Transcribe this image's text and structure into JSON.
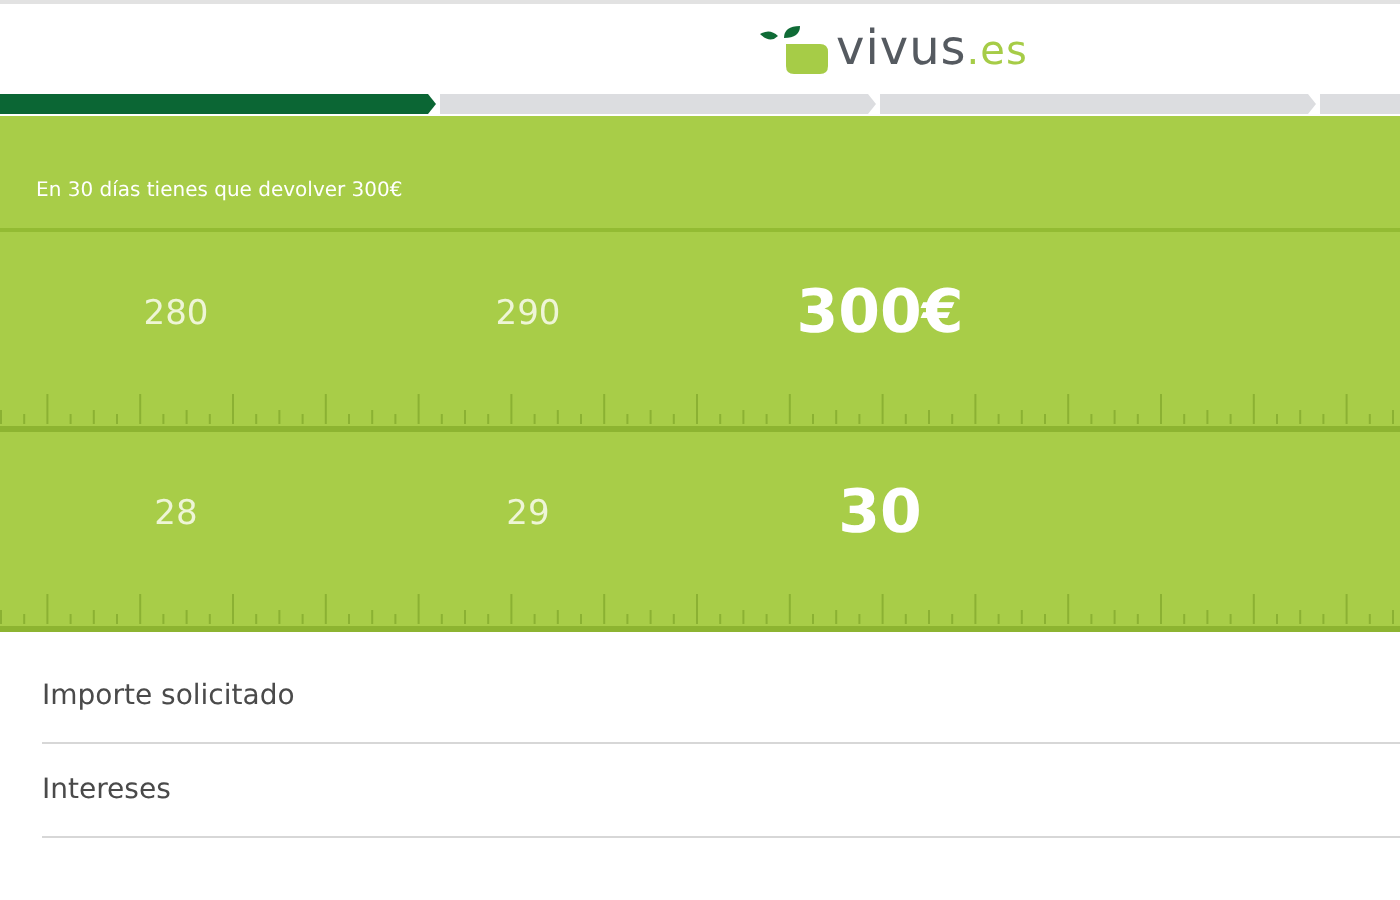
{
  "logo": {
    "name": "vivus",
    "suffix": ".es"
  },
  "progress": {
    "steps": [
      {
        "done": true
      },
      {
        "done": false
      },
      {
        "done": false
      },
      {
        "done": false
      }
    ]
  },
  "summary": "En 30 días tienes que devolver 300€",
  "rulers": [
    {
      "labels": [
        {
          "text": "280",
          "selected": false
        },
        {
          "text": "290",
          "selected": false
        },
        {
          "text": "300€",
          "selected": true
        }
      ]
    },
    {
      "labels": [
        {
          "text": "28",
          "selected": false
        },
        {
          "text": "29",
          "selected": false
        },
        {
          "text": "30",
          "selected": true
        }
      ]
    }
  ],
  "details": [
    {
      "label": "Importe solicitado"
    },
    {
      "label": "Intereses"
    }
  ]
}
